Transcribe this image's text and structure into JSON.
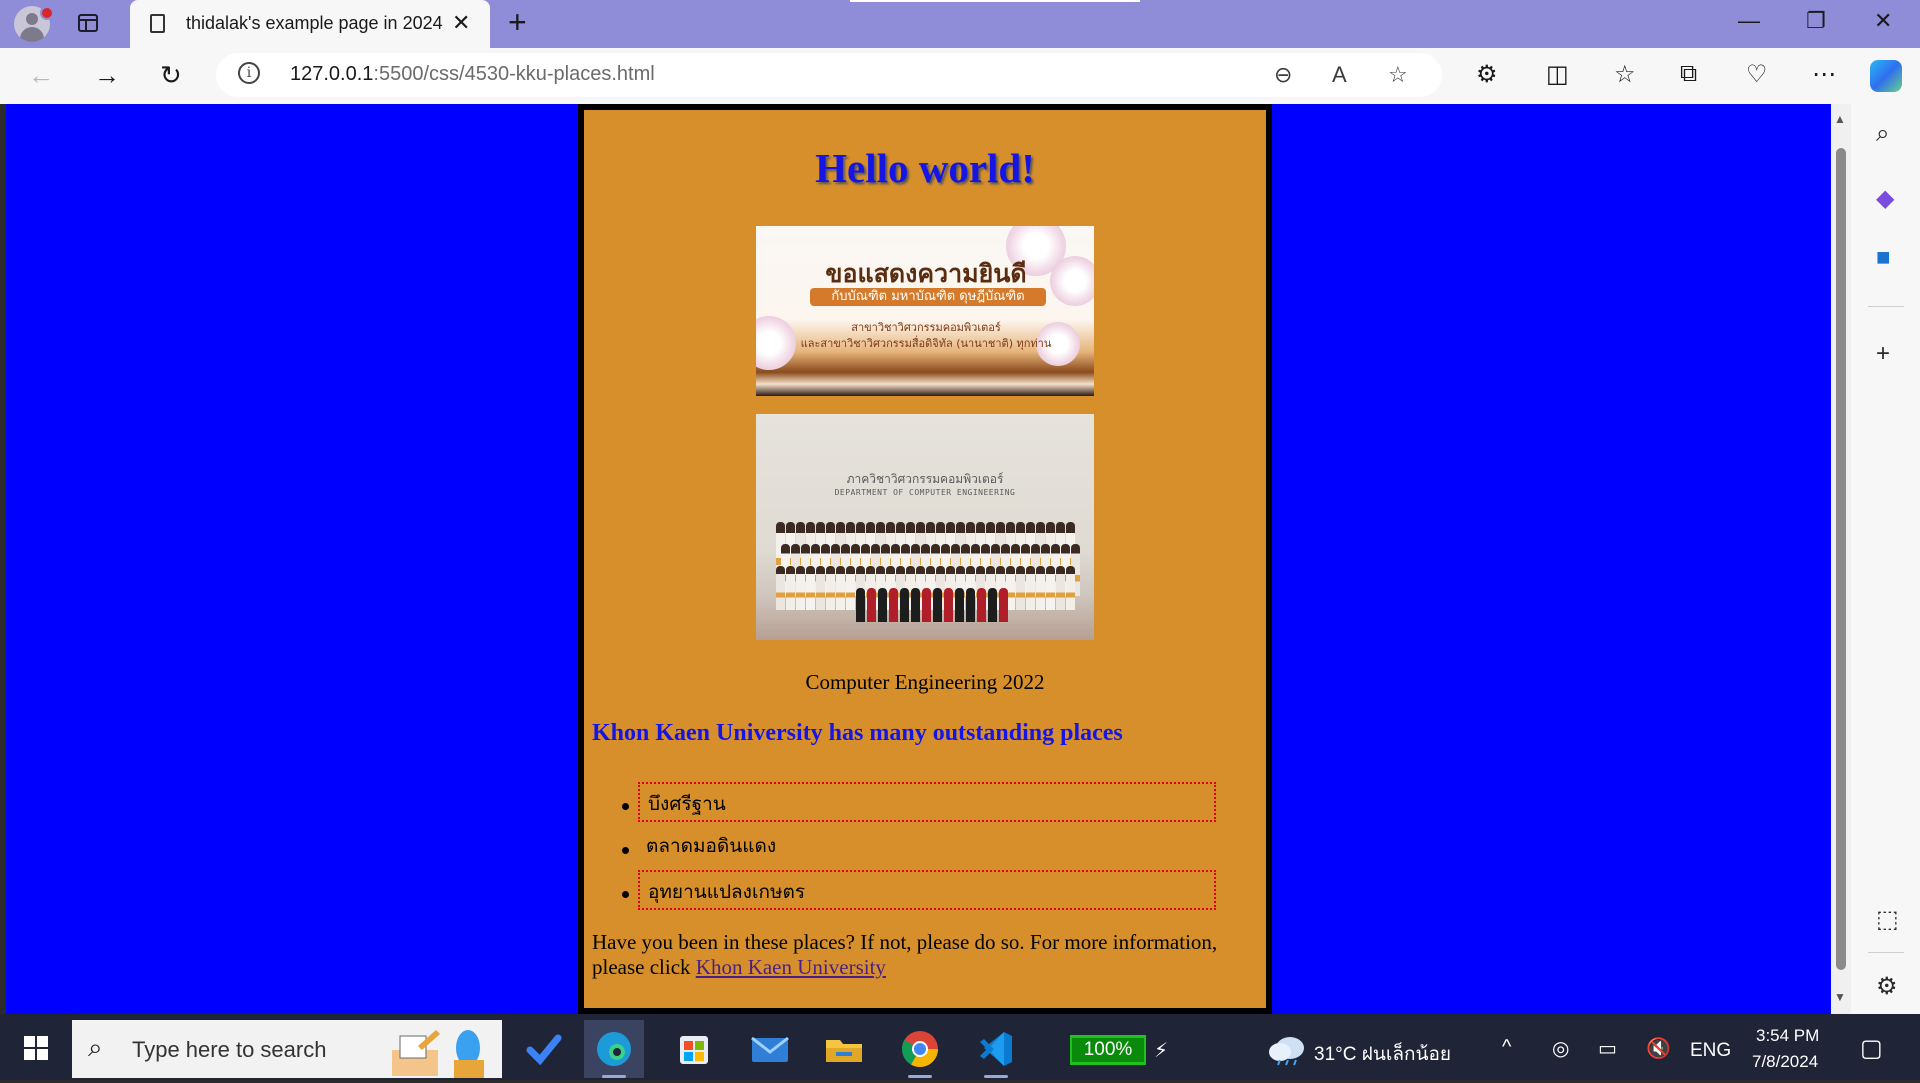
{
  "browser": {
    "tab_title": "thidalak's example page in 2024",
    "url_host": "127.0.0.1",
    "url_rest": ":5500/css/4530-kku-places.html"
  },
  "page": {
    "heading": "Hello world!",
    "banner": {
      "line1": "ขอแสดงความยินดี",
      "line2": "กับบัณฑิต มหาบัณฑิต ดุษฎีบัณฑิต",
      "line3": "สาขาวิชาวิศวกรรมคอมพิวเตอร์",
      "line4": "และสาขาวิชาวิศวกรรมสื่อดิจิทัล (นานาชาติ) ทุกท่าน"
    },
    "photo": {
      "sign_th": "ภาควิชาวิศวกรรมคอมพิวเตอร์",
      "sign_en": "DEPARTMENT OF COMPUTER ENGINEERING"
    },
    "caption": "Computer Engineering 2022",
    "subheading": "Khon Kaen University has many outstanding places",
    "places": [
      "บึงศรีฐาน",
      "ตลาดมอดินแดง",
      "อุทยานแปลงเกษตร"
    ],
    "paragraph_text": "Have you been in these places? If not, please do so. For more information, please click ",
    "link_text": "Khon Kaen University"
  },
  "taskbar": {
    "search_placeholder": "Type here to search",
    "battery": "100%",
    "weather": "31°C  ฝนเล็กน้อย",
    "language": "ENG",
    "time": "3:54 PM",
    "date": "7/8/2024"
  },
  "colors": {
    "page_background": "#0000ff",
    "container_background": "#d68f2a",
    "heading_color": "#1515e6",
    "dotted_border": "#e00000"
  }
}
